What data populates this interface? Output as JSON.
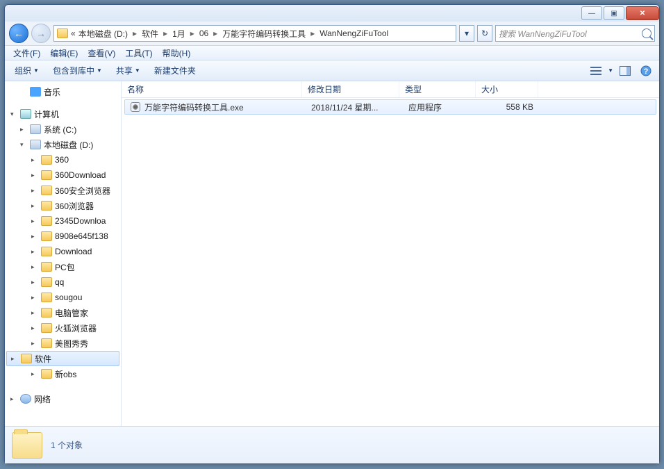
{
  "window_controls": {
    "min": "—",
    "max": "▣",
    "close": "✕"
  },
  "nav": {
    "back": "←",
    "forward": "→"
  },
  "breadcrumb": {
    "prefix": "«",
    "parts": [
      "本地磁盘 (D:)",
      "软件",
      "1月",
      "06",
      "万能字符编码转换工具",
      "WanNengZiFuTool"
    ]
  },
  "addr_actions": {
    "dropdown": "▾",
    "refresh": "↻"
  },
  "search": {
    "placeholder": "搜索 WanNengZiFuTool"
  },
  "menubar": [
    "文件(F)",
    "编辑(E)",
    "查看(V)",
    "工具(T)",
    "帮助(H)"
  ],
  "toolbar": {
    "organize": "组织",
    "include": "包含到库中",
    "share": "共享",
    "newfolder": "新建文件夹"
  },
  "columns": {
    "name": "名称",
    "date": "修改日期",
    "type": "类型",
    "size": "大小"
  },
  "files": [
    {
      "name": "万能字符编码转换工具.exe",
      "date": "2018/11/24 星期...",
      "type": "应用程序",
      "size": "558 KB"
    }
  ],
  "tree": {
    "music": "音乐",
    "computer": "计算机",
    "sys_c": "系统 (C:)",
    "local_d": "本地磁盘 (D:)",
    "folders": [
      "360",
      "360Download",
      "360安全浏览器",
      "360浏览器",
      "2345Downloa",
      "8908e645f138",
      "Download",
      "PC包",
      "qq",
      "sougou",
      "电脑管家",
      "火狐浏览器",
      "美图秀秀",
      "软件",
      "新obs"
    ],
    "network": "网络"
  },
  "details": {
    "count": "1 个对象"
  }
}
